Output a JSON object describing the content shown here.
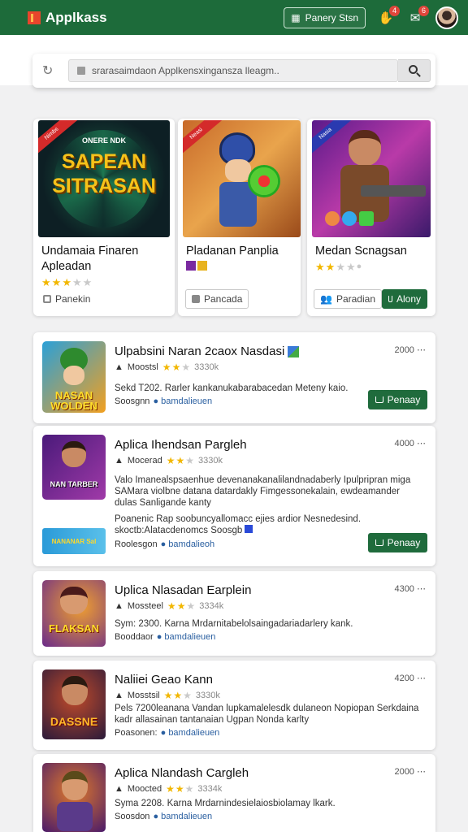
{
  "header": {
    "brand": "Applkass",
    "button": "Panery Stsn",
    "bell_badge": "4",
    "chat_badge": "6"
  },
  "search": {
    "text": "srarasaimdaon Applkensxingansza lleagm.."
  },
  "featured": [
    {
      "ribbon": "Nimbs",
      "img_text": "SAPEAN SITRASAN",
      "img_small": "ONERE NDK",
      "title1": "Undamaia Finaren",
      "title2": "Apleadan",
      "rating": 3,
      "btn": "Panekin"
    },
    {
      "ribbon": "Neasi",
      "title1": "Pladanan Panplia",
      "title2": "",
      "rating": 0,
      "btn": "Pancada"
    },
    {
      "ribbon": "Nasia",
      "title1": "Medan Scnagsan",
      "title2": "",
      "rating": 2,
      "btn": "Paradian",
      "btn2": "Alony"
    }
  ],
  "rows": [
    {
      "title": "Ulpabsini Naran 2caox Nasdasi",
      "meta": "Moostsl",
      "rating": 2,
      "size": "3330k",
      "count": "2000",
      "desc": "Sekd T202. Rarler kankanukabarabacedan Meteny kaio.",
      "sub": "Soosgnn",
      "link": "bamdalieuen",
      "btn": "Penaay",
      "icon_text": "NASAN WOLDEN"
    },
    {
      "title": "Aplica Ihendsan Pargleh",
      "meta": "Mocerad",
      "rating": 2,
      "size": "3330k",
      "count": "4000",
      "desc": "Valo Imanealspsaenhue devenanakanalilandnadaberly Ipulpripran miga SAMara violbne datana datardakly Fimgessonekalain, ewdeamander dulas Sanligande kanty",
      "desc2": "Poanenic Rap soobuncyallomacc ejies ardior Nesnedesind. skoctb:Alatacdenomcs Soosgb",
      "sub": "Roolesgon",
      "link": "bamdalieoh",
      "btn": "Penaay",
      "icon_text": "NAN TARBER",
      "ad_text": "NANANAR Sal"
    },
    {
      "title": "Uplica Nlasadan Earplein",
      "meta": "Mossteel",
      "rating": 2,
      "size": "3334k",
      "count": "4300",
      "desc": "Sym: 2300. Karna Mrdarnitabelolsaingadariadarlery kank.",
      "sub": "Booddaor",
      "link": "bamdalieuen",
      "icon_text": "FLAKSAN"
    },
    {
      "title": "Naliiei Geao Kann",
      "meta": "Mosstsil",
      "rating": 2,
      "size": "3330k",
      "count": "4200",
      "desc": "Pels 7200leanana Vandan lupkamalelesdk dulaneon Nopiopan Serkdaina kadr allasainan tantanaian Ugpan Nonda karlty",
      "sub": "Poasonen:",
      "link": "bamdalieuen",
      "icon_text": "DASSNE"
    },
    {
      "title": "Aplica Nlandash Cargleh",
      "meta": "Moocted",
      "rating": 2,
      "size": "3334k",
      "count": "2000",
      "desc": "Syma 2208. Karna Mrdarnindesielaiosbiolamay lkark.",
      "sub": "Soosdon",
      "link": "bamdalieuen",
      "icon_text": ""
    }
  ],
  "colors": {
    "brand": "#1d6b3a",
    "star": "#f2b700",
    "link": "#2a5fa0"
  }
}
